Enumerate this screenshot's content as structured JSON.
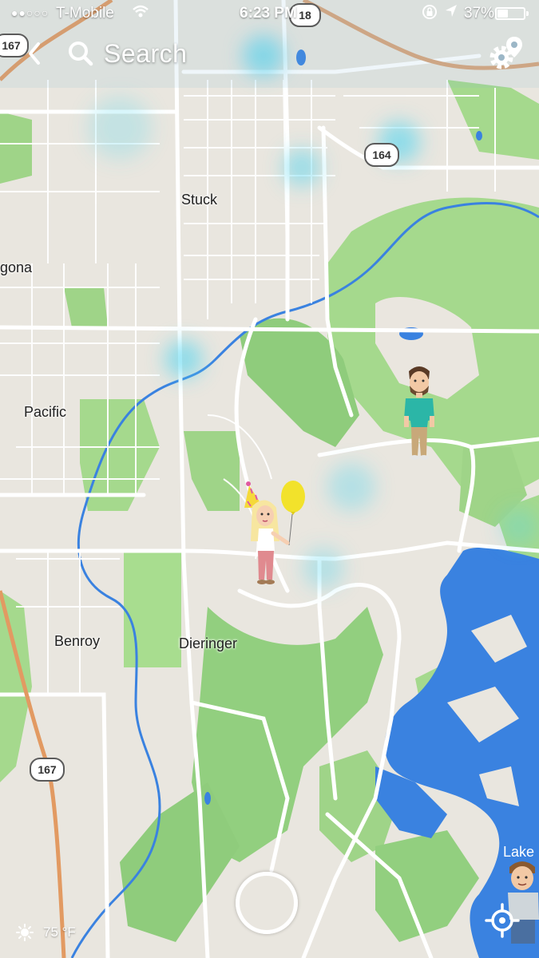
{
  "status_bar": {
    "signal": "●●○○○",
    "carrier": "T-Mobile",
    "time": "6:23 PM",
    "battery_percent": "37%",
    "battery_level": 0.37
  },
  "top_bar": {
    "search_label": "Search"
  },
  "map": {
    "places": {
      "stuck": "Stuck",
      "algona": "gona",
      "pacific": "Pacific",
      "benroy": "Benroy",
      "dieringer": "Dieringer",
      "lake": "Lake"
    },
    "route_shields": {
      "top_left": "167",
      "top_center": "18",
      "east": "164",
      "bottom_left": "167"
    }
  },
  "weather": {
    "temperature": "75 °F",
    "icon": "sun-icon"
  },
  "colors": {
    "water": "#3a82e0",
    "park": "#a8d890",
    "forest": "#8cc97a",
    "land": "#e9e6df",
    "road": "#ffffff",
    "highway": "#e29a62",
    "heatmap": "#52d6f0"
  }
}
